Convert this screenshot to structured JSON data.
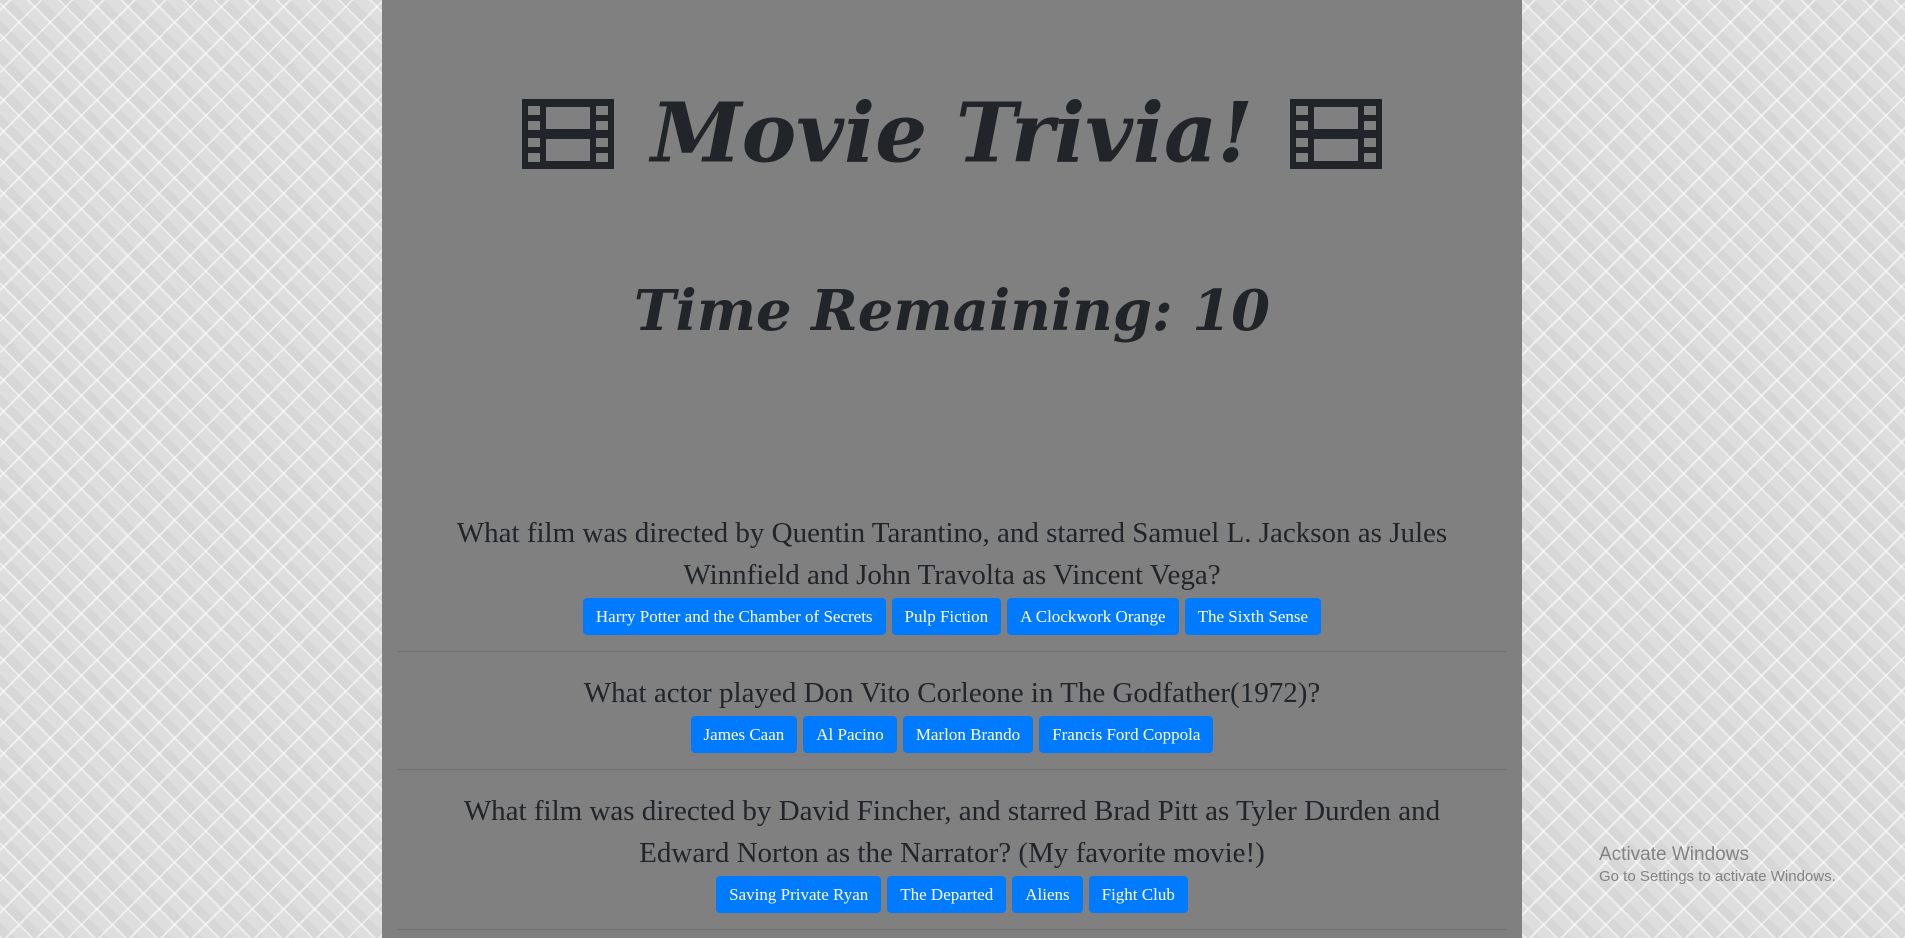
{
  "header": {
    "title": "Movie Trivia!",
    "icon": "film-icon"
  },
  "timer": {
    "label": "Time Remaining: 10"
  },
  "questions": [
    {
      "text": "What film was directed by Quentin Tarantino, and starred Samuel L. Jackson as Jules Winnfield and John Travolta as Vincent Vega?",
      "answers": [
        "Harry Potter and the Chamber of Secrets",
        "Pulp Fiction",
        "A Clockwork Orange",
        "The Sixth Sense"
      ]
    },
    {
      "text": "What actor played Don Vito Corleone in The Godfather(1972)?",
      "answers": [
        "James Caan",
        "Al Pacino",
        "Marlon Brando",
        "Francis Ford Coppola"
      ]
    },
    {
      "text": "What film was directed by David Fincher, and starred Brad Pitt as Tyler Durden and Edward Norton as the Narrator? (My favorite movie!)",
      "answers": [
        "Saving Private Ryan",
        "The Departed",
        "Aliens",
        "Fight Club"
      ]
    }
  ],
  "watermark": {
    "title": "Activate Windows",
    "subtitle": "Go to Settings to activate Windows."
  },
  "colors": {
    "panel": "#808080",
    "text": "#212529",
    "button": "#007bff"
  }
}
